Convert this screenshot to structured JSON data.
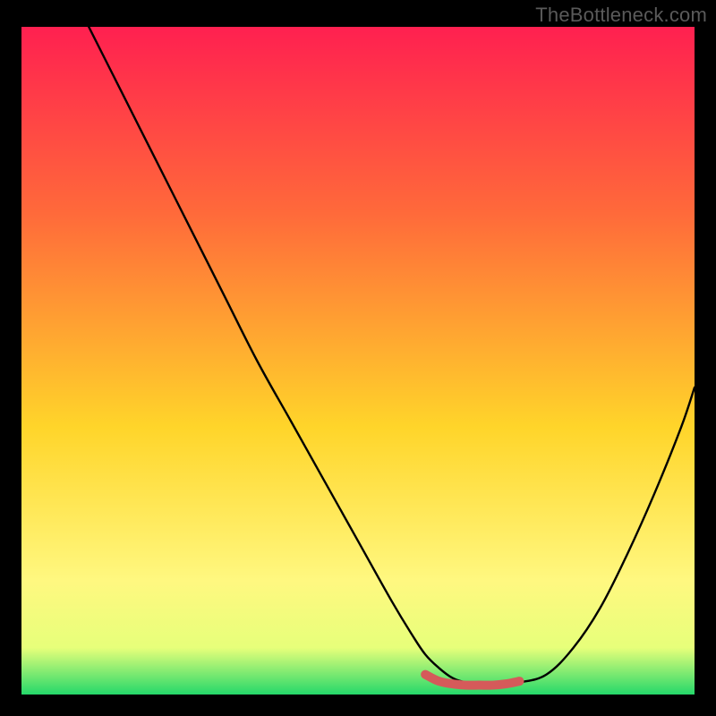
{
  "watermark": "TheBottleneck.com",
  "chart_data": {
    "type": "line",
    "title": "",
    "xlabel": "",
    "ylabel": "",
    "xlim": [
      0,
      100
    ],
    "ylim": [
      0,
      100
    ],
    "grid": false,
    "legend": false,
    "background_gradient": {
      "top": "#ff2050",
      "mid_upper": "#ff6a3a",
      "mid": "#ffd52a",
      "mid_lower": "#fff880",
      "bottom": "#25d86a"
    },
    "series": [
      {
        "name": "bottleneck-curve",
        "color": "#000000",
        "x": [
          10,
          15,
          20,
          25,
          30,
          35,
          40,
          45,
          50,
          55,
          58,
          60,
          62,
          64,
          66,
          68,
          70,
          72,
          74,
          78,
          82,
          86,
          90,
          94,
          98,
          100
        ],
        "y": [
          100,
          90,
          80,
          70,
          60,
          50,
          41,
          32,
          23,
          14,
          9,
          6,
          4,
          2.5,
          1.8,
          1.5,
          1.5,
          1.5,
          1.8,
          3,
          7,
          13,
          21,
          30,
          40,
          46
        ]
      },
      {
        "name": "optimal-segment",
        "color": "#d55a5a",
        "stroke_width": 10,
        "linecap": "round",
        "x": [
          60,
          62,
          64,
          66,
          68,
          70,
          72,
          74
        ],
        "y": [
          3.0,
          2.0,
          1.6,
          1.4,
          1.4,
          1.4,
          1.6,
          2.0
        ]
      }
    ]
  }
}
